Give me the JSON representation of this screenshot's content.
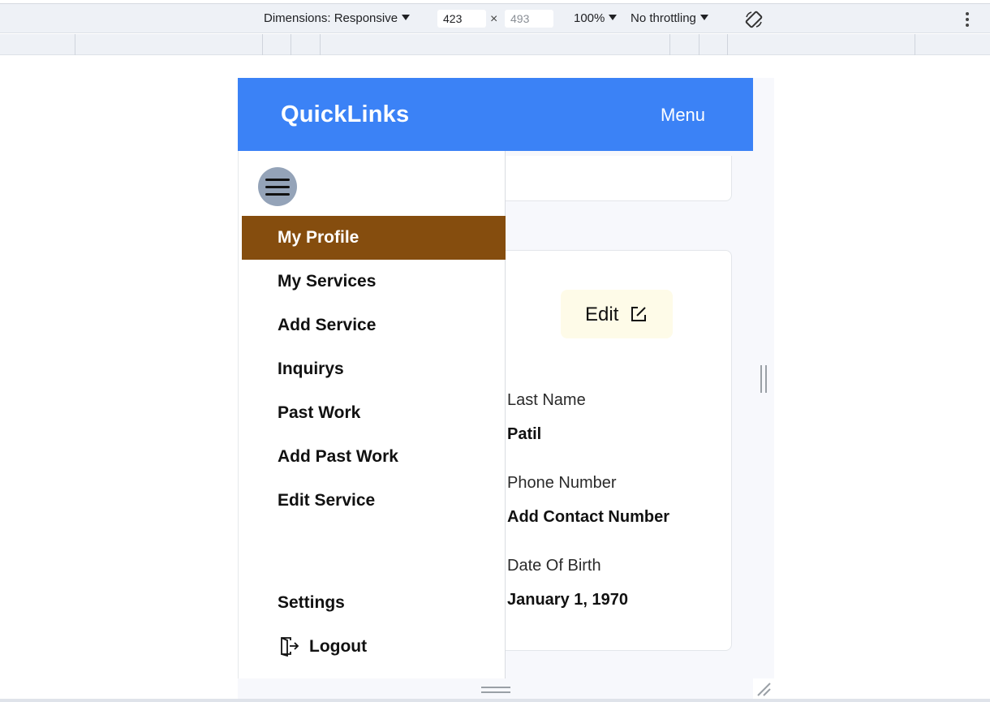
{
  "devtools": {
    "dimensions_label": "Dimensions: Responsive",
    "width_value": "423",
    "height_value": "493",
    "times_sign": "×",
    "zoom_label": "100%",
    "throttling_label": "No throttling",
    "icons": [
      "rotate-icon",
      "kebab-menu-icon"
    ]
  },
  "header": {
    "brand": "QuickLinks",
    "menu_label": "Menu",
    "color": "#3b82f6"
  },
  "drawer": {
    "items": [
      {
        "label": "My Profile",
        "active": true
      },
      {
        "label": "My Services"
      },
      {
        "label": "Add Service"
      },
      {
        "label": "Inquirys"
      },
      {
        "label": "Past Work"
      },
      {
        "label": "Add Past Work"
      },
      {
        "label": "Edit Service"
      }
    ],
    "settings_label": "Settings",
    "logout_label": "Logout",
    "active_color": "#854d0e",
    "hamburger_color": "#94a3b8"
  },
  "profile": {
    "edit_label": "Edit",
    "fields": [
      {
        "label": "Last Name",
        "value": "Patil"
      },
      {
        "label": "Phone Number",
        "value": "Add Contact Number"
      },
      {
        "label": "Date Of Birth",
        "value": "January 1, 1970"
      }
    ]
  }
}
